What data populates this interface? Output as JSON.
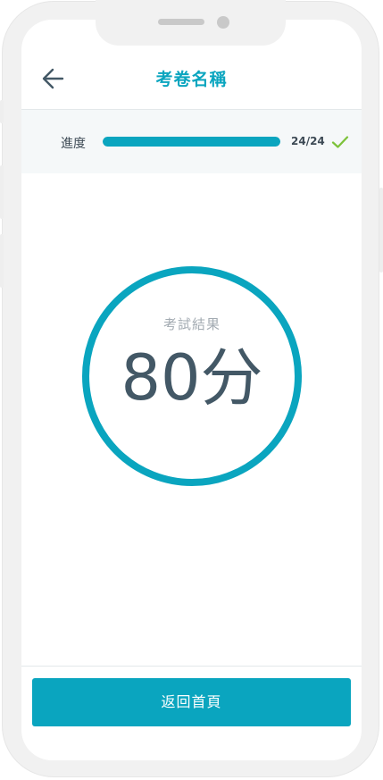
{
  "header": {
    "title": "考卷名稱",
    "back_icon": "arrow-left-icon"
  },
  "progress": {
    "label": "進度",
    "current": 24,
    "total": 24,
    "fraction": 1.0,
    "count_text": "24/24",
    "complete_icon": "check-icon",
    "fill_color": "#0aa5bf",
    "check_color": "#7cc23a"
  },
  "result": {
    "label": "考試結果",
    "score_text": "80分",
    "ring_color": "#0aa5bf"
  },
  "footer": {
    "home_button_label": "返回首頁"
  },
  "colors": {
    "accent": "#0aa5bf",
    "text_dark": "#435866",
    "text_muted": "#a3abb2"
  }
}
